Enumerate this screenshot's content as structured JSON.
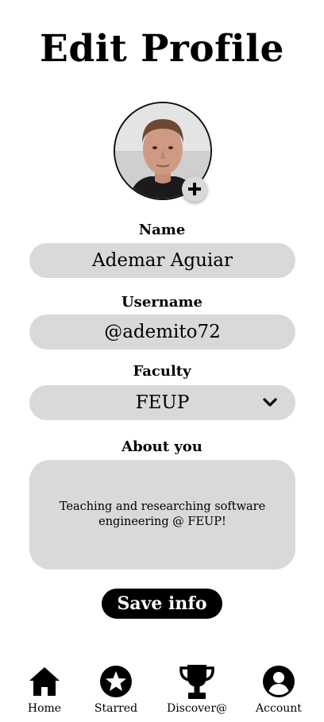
{
  "page": {
    "title": "Edit Profile"
  },
  "avatar": {
    "add_icon": "plus-icon"
  },
  "form": {
    "name": {
      "label": "Name",
      "value": "Ademar Aguiar"
    },
    "username": {
      "label": "Username",
      "value": "@ademito72"
    },
    "faculty": {
      "label": "Faculty",
      "value": "FEUP",
      "icon": "chevron-down-icon"
    },
    "about": {
      "label": "About you",
      "value": "Teaching and researching software engineering @ FEUP!"
    }
  },
  "actions": {
    "save_label": "Save info"
  },
  "nav": {
    "items": [
      {
        "label": "Home",
        "icon": "home-icon"
      },
      {
        "label": "Starred",
        "icon": "star-icon"
      },
      {
        "label": "Discover@",
        "icon": "trophy-icon"
      },
      {
        "label": "Account",
        "icon": "account-icon"
      }
    ]
  },
  "colors": {
    "field_bg": "#d9d9d9",
    "button_bg": "#000000",
    "button_text": "#ffffff"
  }
}
